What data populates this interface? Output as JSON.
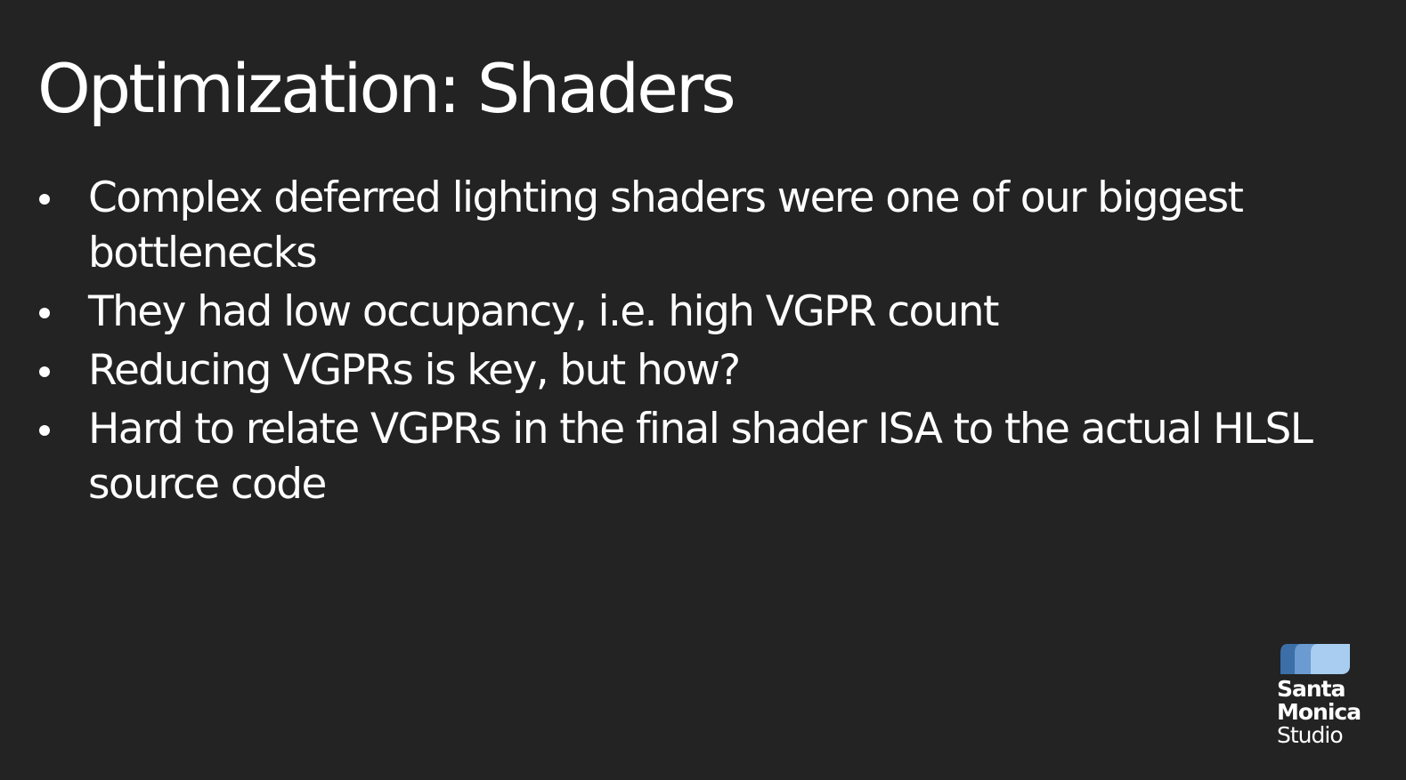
{
  "slide": {
    "title": "Optimization: Shaders",
    "bullets": [
      "Complex deferred lighting shaders were one of our biggest bottlenecks",
      "They had low occupancy, i.e. high VGPR count",
      "Reducing VGPRs is key, but how?",
      "Hard to relate VGPRs in the final shader ISA to the actual HLSL source code"
    ]
  },
  "logo": {
    "line1": "Santa",
    "line2": "Monica",
    "line3": "Studio",
    "colors": [
      "#3c6fa8",
      "#6b9bd0",
      "#a8cdf0"
    ]
  },
  "theme": {
    "background": "#232323",
    "text": "#ffffff"
  }
}
